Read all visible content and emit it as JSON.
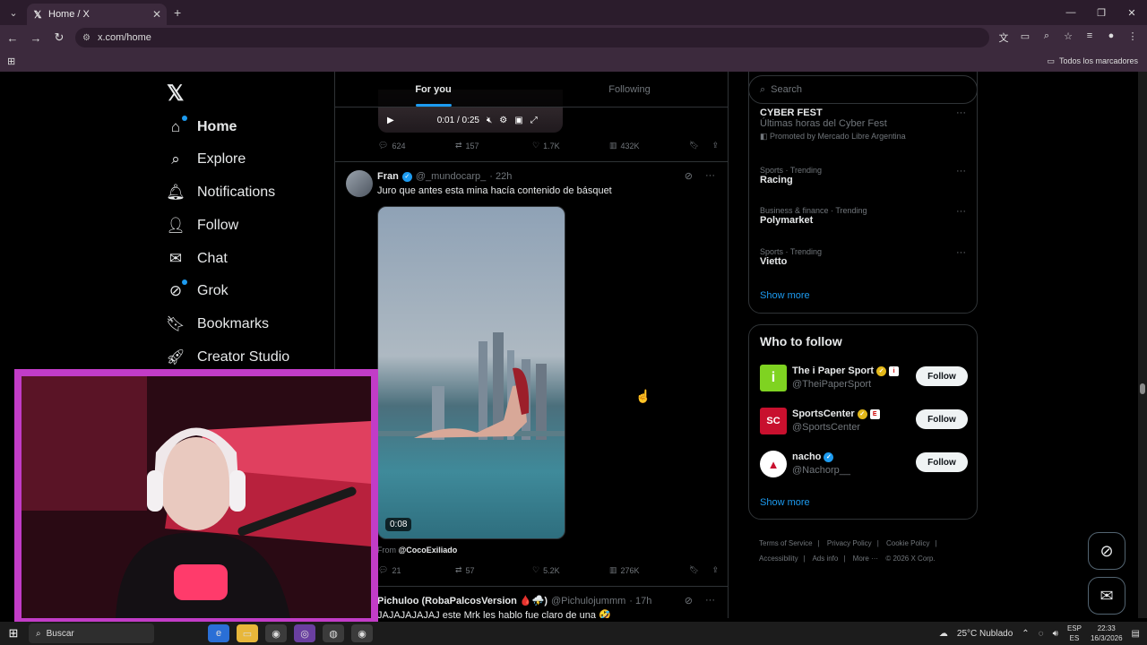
{
  "browser": {
    "tab_title": "Home / X",
    "url": "x.com/home",
    "bookmarks_label": "Todos los marcadores"
  },
  "nav": {
    "items": [
      {
        "label": "Home",
        "icon": "home-icon"
      },
      {
        "label": "Explore",
        "icon": "search-icon"
      },
      {
        "label": "Notifications",
        "icon": "bell-icon"
      },
      {
        "label": "Follow",
        "icon": "person-plus-icon"
      },
      {
        "label": "Chat",
        "icon": "mail-icon"
      },
      {
        "label": "Grok",
        "icon": "grok-icon"
      },
      {
        "label": "Bookmarks",
        "icon": "bookmark-icon"
      },
      {
        "label": "Creator Studio",
        "icon": "rocket-icon"
      }
    ]
  },
  "feed": {
    "tabs": [
      "For you",
      "Following"
    ],
    "prev_post": {
      "video_time": "0:01 / 0:25",
      "replies": "624",
      "reposts": "157",
      "likes": "1.7K",
      "views": "432K"
    },
    "post": {
      "name": "Fran",
      "handle": "@_mundocarp_",
      "time": "· 22h",
      "text": "Juro que antes esta mina hacía contenido de básquet",
      "video_duration": "0:08",
      "from_label": "From",
      "from_handle": "@CocoExiliado",
      "replies": "21",
      "reposts": "57",
      "likes": "5.2K",
      "views": "276K"
    },
    "next_post": {
      "name": "Pichuloo (RobaPalcosVersion 🩸⛈️)",
      "handle": "@Pichulojummm",
      "time": "· 17h",
      "text": "JAJAJAJAJAJ este Mrk les hablo fue claro de una 🤣"
    }
  },
  "sidebar": {
    "search_placeholder": "Search",
    "trends": [
      {
        "meta": "",
        "title": "CYBER FEST",
        "sub": "Últimas horas del Cyber Fest",
        "promo": "Promoted by Mercado Libre Argentina"
      },
      {
        "meta": "Sports · Trending",
        "title": "Racing"
      },
      {
        "meta": "Business & finance · Trending",
        "title": "Polymarket"
      },
      {
        "meta": "Sports · Trending",
        "title": "Vietto"
      }
    ],
    "show_more": "Show more",
    "who_to_follow": {
      "title": "Who to follow",
      "accounts": [
        {
          "name": "The i Paper Sport",
          "handle": "@TheiPaperSport",
          "button": "Follow",
          "color": "#7fd321",
          "glyph": "i"
        },
        {
          "name": "SportsCenter",
          "handle": "@SportsCenter",
          "button": "Follow",
          "color": "#c8102e",
          "glyph": "SC"
        },
        {
          "name": "nacho",
          "handle": "@Nachorp__",
          "button": "Follow",
          "color": "#ffffff",
          "glyph": "▲"
        }
      ],
      "show_more": "Show more"
    },
    "footer": [
      "Terms of Service",
      "|",
      "Privacy Policy",
      "|",
      "Cookie Policy",
      "|",
      "Accessibility",
      "|",
      "Ads info",
      "|",
      "More ···",
      "© 2026 X Corp."
    ]
  },
  "taskbar": {
    "search": "Buscar",
    "weather": "25°C  Nublado",
    "lang_top": "ESP",
    "lang_bottom": "ES",
    "time": "22:33",
    "date": "16/3/2026"
  }
}
